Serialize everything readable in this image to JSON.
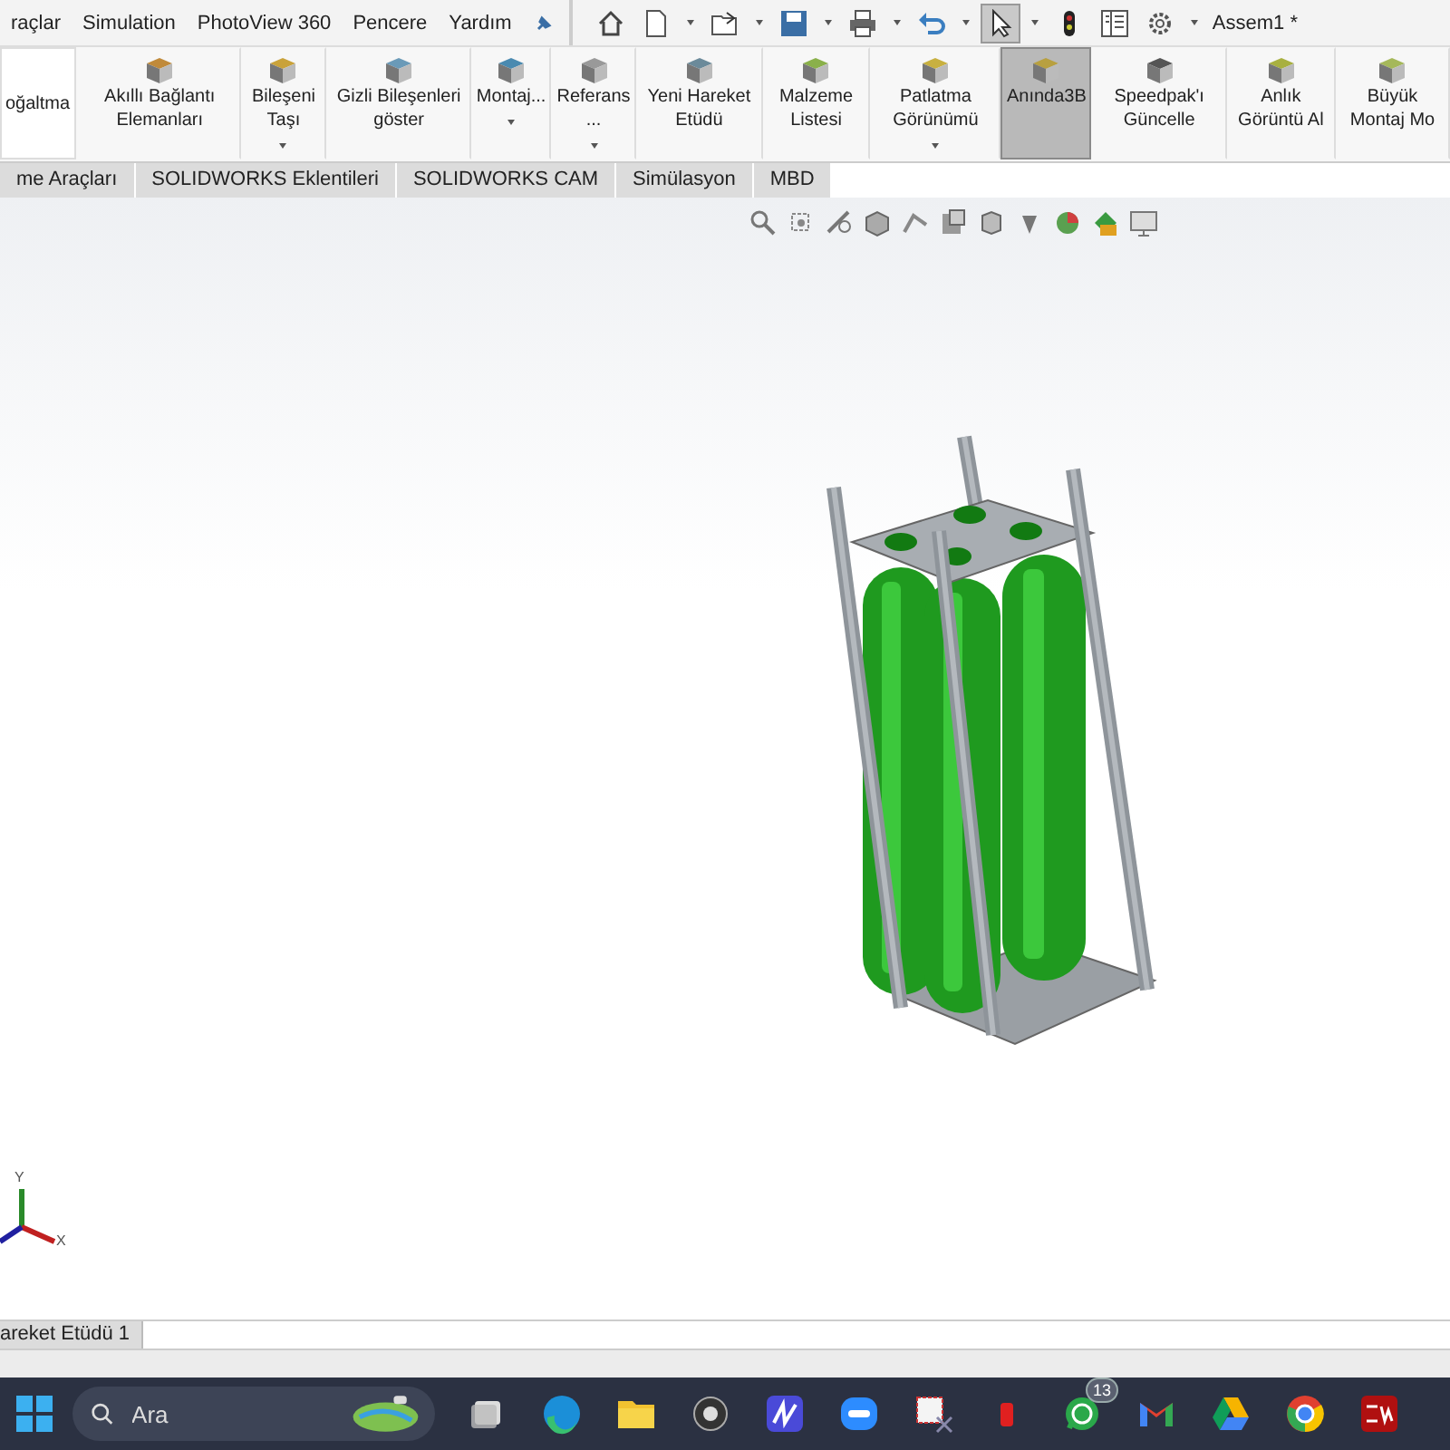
{
  "menu_bar": {
    "items": [
      "raçlar",
      "Simulation",
      "PhotoView 360",
      "Pencere",
      "Yardım"
    ],
    "quick_access": [
      {
        "kind": "home",
        "dropdown": false,
        "selected": false
      },
      {
        "kind": "document",
        "dropdown": true,
        "selected": false
      },
      {
        "kind": "folder",
        "dropdown": true,
        "selected": false
      },
      {
        "kind": "save",
        "dropdown": true,
        "selected": false
      },
      {
        "kind": "print",
        "dropdown": true,
        "selected": false
      },
      {
        "kind": "undo",
        "dropdown": true,
        "selected": false
      },
      {
        "kind": "pointer",
        "dropdown": true,
        "selected": true
      },
      {
        "kind": "light",
        "dropdown": false,
        "selected": false
      },
      {
        "kind": "list",
        "dropdown": false,
        "selected": false
      },
      {
        "kind": "gear",
        "dropdown": true,
        "selected": false
      }
    ],
    "title": "Assem1 *"
  },
  "ribbon": [
    {
      "label": "oğaltma",
      "kind": "field",
      "selected": false
    },
    {
      "label": "Akıllı Bağlantı Elemanları",
      "kind": "button",
      "dropdown": false,
      "selected": false
    },
    {
      "label": "Bileşeni Taşı",
      "kind": "button",
      "dropdown": true,
      "selected": false
    },
    {
      "label": "Gizli Bileşenleri göster",
      "kind": "button",
      "dropdown": false,
      "selected": false
    },
    {
      "label": "Montaj...",
      "kind": "button",
      "dropdown": true,
      "selected": false
    },
    {
      "label": "Referans ...",
      "kind": "button",
      "dropdown": true,
      "selected": false
    },
    {
      "label": "Yeni Hareket Etüdü",
      "kind": "button",
      "dropdown": false,
      "selected": false
    },
    {
      "label": "Malzeme Listesi",
      "kind": "button",
      "dropdown": false,
      "selected": false
    },
    {
      "label": "Patlatma Görünümü",
      "kind": "button",
      "dropdown": true,
      "selected": false
    },
    {
      "label": "Anında3B",
      "kind": "button",
      "dropdown": false,
      "selected": true
    },
    {
      "label": "Speedpak'ı Güncelle",
      "kind": "button",
      "dropdown": false,
      "selected": false
    },
    {
      "label": "Anlık Görüntü Al",
      "kind": "button",
      "dropdown": false,
      "selected": false
    },
    {
      "label": "Büyük Montaj Mo",
      "kind": "button",
      "dropdown": false,
      "selected": false
    }
  ],
  "tabs": [
    {
      "label": "me Araçları",
      "selected": false
    },
    {
      "label": "SOLIDWORKS Eklentileri",
      "selected": false
    },
    {
      "label": "SOLIDWORKS CAM",
      "selected": false
    },
    {
      "label": "Simülasyon",
      "selected": false
    },
    {
      "label": "MBD",
      "selected": false
    }
  ],
  "viewport": {
    "axis_labels": {
      "y": "Y",
      "x": "X"
    }
  },
  "bottom_tabs": [
    {
      "label": "areket Etüdü 1",
      "selected": true
    }
  ],
  "taskbar": {
    "items": [
      {
        "kind": "start"
      },
      {
        "kind": "search",
        "placeholder": "Ara"
      },
      {
        "kind": "taskview"
      },
      {
        "kind": "edge"
      },
      {
        "kind": "folder"
      },
      {
        "kind": "obs"
      },
      {
        "kind": "mapp"
      },
      {
        "kind": "zoom"
      },
      {
        "kind": "snip"
      },
      {
        "kind": "redapp"
      },
      {
        "kind": "whatsapp",
        "badge": "13"
      },
      {
        "kind": "gmail"
      },
      {
        "kind": "drive"
      },
      {
        "kind": "chrome"
      },
      {
        "kind": "solidworks"
      }
    ]
  }
}
